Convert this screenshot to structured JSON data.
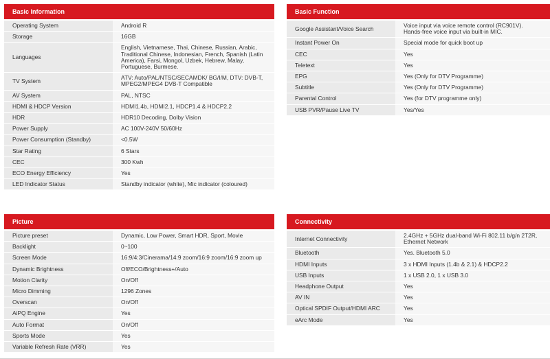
{
  "panels": [
    {
      "title": "Basic Information",
      "rows": [
        {
          "key": "Operating System",
          "value": "Android R"
        },
        {
          "key": "Storage",
          "value": "16GB"
        },
        {
          "key": "Languages",
          "value": "English, Vietnamese, Thai, Chinese, Russian, Arabic, Traditional Chinese, Indonesian, French, Spanish (Latin America), Farsi, Mongol, Uzbek, Hebrew, Malay, Portuguese, Burmese."
        },
        {
          "key": "TV System",
          "value": "ATV: Auto/PAL/NTSC/SECAMDK/ BG/I/M, DTV: DVB-T, MPEG2/MPEG4 DVB-T Compatible"
        },
        {
          "key": "AV System",
          "value": "PAL, NTSC"
        },
        {
          "key": "HDMI & HDCP Version",
          "value": "HDMI1.4b, HDMI2.1, HDCP1.4 & HDCP2.2"
        },
        {
          "key": "HDR",
          "value": "HDR10 Decoding, Dolby Vision"
        },
        {
          "key": "Power Supply",
          "value": "AC 100V-240V 50/60Hz"
        },
        {
          "key": "Power Consumption (Standby)",
          "value": "<0.5W"
        },
        {
          "key": "Star Rating",
          "value": "6 Stars"
        },
        {
          "key": "CEC",
          "value": "300 Kwh"
        },
        {
          "key": "ECO Energy Efficiency",
          "value": "Yes"
        },
        {
          "key": "LED Indicator Status",
          "value": "Standby indicator (white), Mic indicator (coloured)"
        }
      ]
    },
    {
      "title": "Basic Function",
      "rows": [
        {
          "key": "Google Assistant/Voice Search",
          "value": "Voice input via voice remote control (RC901V). Hands-free voice input via built-in MIC."
        },
        {
          "key": "Instant Power On",
          "value": "Special mode for quick boot up"
        },
        {
          "key": "CEC",
          "value": "Yes"
        },
        {
          "key": "Teletext",
          "value": "Yes"
        },
        {
          "key": "EPG",
          "value": "Yes (Only for DTV Programme)"
        },
        {
          "key": "Subtitle",
          "value": "Yes (Only for DTV Programme)"
        },
        {
          "key": "Parental Control",
          "value": "Yes (for DTV programme only)"
        },
        {
          "key": "USB PVR/Pause Live TV",
          "value": "Yes/Yes"
        }
      ]
    },
    {
      "title": "Picture",
      "rows": [
        {
          "key": "Picture preset",
          "value": "Dynamic, Low Power, Smart HDR, Sport, Movie"
        },
        {
          "key": "Backlight",
          "value": "0~100"
        },
        {
          "key": "Screen Mode",
          "value": "16:9/4:3/Cinerama/14:9 zoom/16:9 zoom/16:9 zoom up"
        },
        {
          "key": "Dynamic Brightness",
          "value": "Off/ECO/Brightness+/Auto"
        },
        {
          "key": "Motion Clarity",
          "value": "On/Off"
        },
        {
          "key": "Micro Dimming",
          "value": "1296 Zones"
        },
        {
          "key": "Overscan",
          "value": "On/Off"
        },
        {
          "key": "AiPQ Engine",
          "value": "Yes"
        },
        {
          "key": "Auto Format",
          "value": "On/Off"
        },
        {
          "key": "Sports Mode",
          "value": "Yes"
        },
        {
          "key": "Variable Refresh Rate (VRR)",
          "value": "Yes"
        }
      ]
    },
    {
      "title": "Connectivity",
      "rows": [
        {
          "key": "Internet Connectivity",
          "value": "2.4GHz + 5GHz dual-band Wi-Fi 802.11 b/g/n 2T2R, Ethernet Network"
        },
        {
          "key": "Bluetooth",
          "value": "Yes. Bluetooth 5.0"
        },
        {
          "key": "HDMI Inputs",
          "value": "3 x HDMI Inputs (1.4b & 2.1) & HDCP2.2"
        },
        {
          "key": "USB Inputs",
          "value": "1 x USB 2.0, 1 x USB 3.0"
        },
        {
          "key": "Headphone Output",
          "value": "Yes"
        },
        {
          "key": "AV IN",
          "value": "Yes"
        },
        {
          "key": "Optical SPDIF Output/HDMI ARC",
          "value": "Yes"
        },
        {
          "key": "eArc Mode",
          "value": "Yes"
        }
      ]
    }
  ],
  "colors": {
    "header": "#d71920",
    "key_cell": "#eaeaea",
    "value_cell": "#f6f6f6"
  }
}
